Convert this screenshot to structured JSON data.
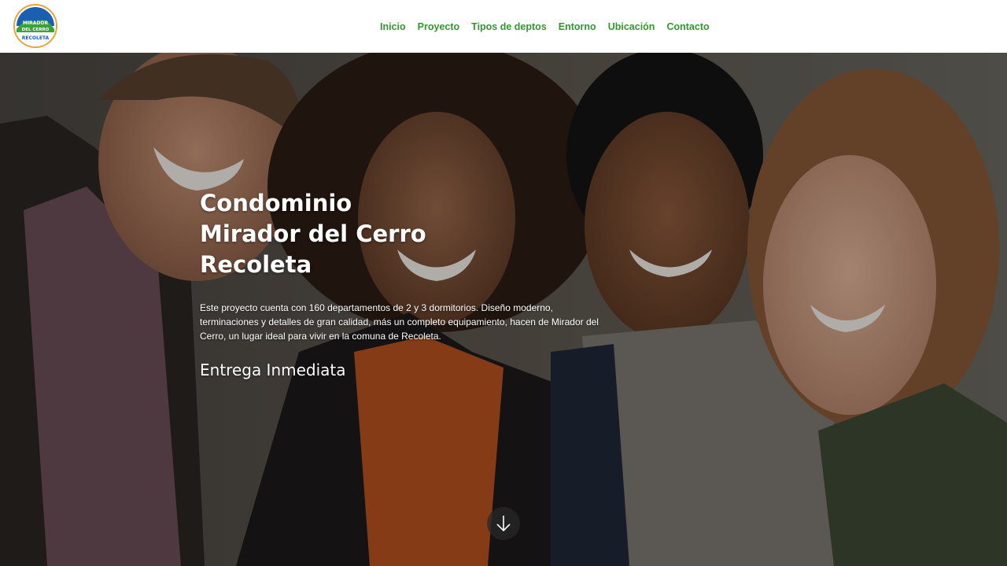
{
  "logo": {
    "line1": "MIRADOR",
    "line2": "DEL CERRO",
    "line3": "RECOLETA",
    "colors": {
      "sky": "#1b5fb0",
      "hill": "#3aa238",
      "ring": "#e9a23b"
    }
  },
  "nav": {
    "items": [
      {
        "label": "Inicio"
      },
      {
        "label": "Proyecto"
      },
      {
        "label": "Tipos de deptos"
      },
      {
        "label": "Entorno"
      },
      {
        "label": "Ubicación"
      },
      {
        "label": "Contacto"
      }
    ],
    "color": "#2f9a2c"
  },
  "hero": {
    "title": "Condominio Mirador del Cerro Recoleta",
    "description": "Este proyecto cuenta con 160 departamentos de 2 y 3 dormitorios. Diseño moderno, terminaciones y detalles de gran calidad, más un completo equipamiento, hacen de Mirador del Cerro, un lugar ideal para vivir en la comuna de Recoleta.",
    "subtitle": "Entrega Inmediata",
    "scroll_icon": "arrow-down-icon"
  }
}
